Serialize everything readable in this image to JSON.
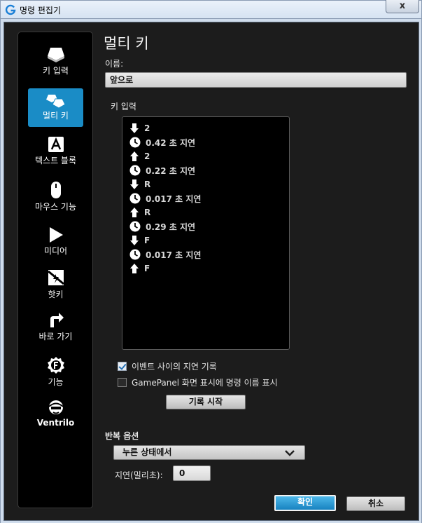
{
  "window": {
    "title": "명령 편집기",
    "close_label": "x"
  },
  "sidebar": {
    "items": [
      {
        "label": "키 입력",
        "icon": "keycap-icon",
        "active": false
      },
      {
        "label": "멀티 키",
        "icon": "multikey-icon",
        "active": true
      },
      {
        "label": "텍스트 블록",
        "icon": "text-a-icon",
        "active": false
      },
      {
        "label": "마우스 기능",
        "icon": "mouse-icon",
        "active": false
      },
      {
        "label": "미디어",
        "icon": "play-icon",
        "active": false
      },
      {
        "label": "핫키",
        "icon": "hotkey-icon",
        "active": false
      },
      {
        "label": "바로 가기",
        "icon": "shortcut-arrow-icon",
        "active": false
      },
      {
        "label": "기능",
        "icon": "function-f-icon",
        "active": false
      },
      {
        "label": "Ventrilo",
        "icon": "headset-icon",
        "active": false
      }
    ]
  },
  "main": {
    "heading": "멀티 키",
    "name_label": "이름:",
    "name_value": "앞으로",
    "keys_label": "키 입력",
    "key_events": [
      {
        "type": "down-arrow-icon",
        "text": "2"
      },
      {
        "type": "clock-icon",
        "text": "0.42 초 지연"
      },
      {
        "type": "up-arrow-icon",
        "text": "2"
      },
      {
        "type": "clock-icon",
        "text": "0.22 초 지연"
      },
      {
        "type": "down-arrow-icon",
        "text": "R"
      },
      {
        "type": "clock-icon",
        "text": "0.017 초 지연"
      },
      {
        "type": "up-arrow-icon",
        "text": "R"
      },
      {
        "type": "clock-icon",
        "text": "0.29 초 지연"
      },
      {
        "type": "down-arrow-icon",
        "text": "F"
      },
      {
        "type": "clock-icon",
        "text": "0.017 초 지연"
      },
      {
        "type": "up-arrow-icon",
        "text": "F"
      }
    ],
    "record_delays_label": "이벤트 사이의 지연 기록",
    "record_delays_checked": true,
    "gamepanel_label": "GamePanel 화면 표시에 명령 이름 표시",
    "gamepanel_checked": false,
    "record_button": "기록 시작"
  },
  "repeat": {
    "label": "반복 옵션",
    "selected": "누른 상태에서",
    "delay_label": "지연(밀리초):",
    "delay_value": "0"
  },
  "footer": {
    "ok": "확인",
    "cancel": "취소"
  },
  "colors": {
    "accent": "#1a8cc6",
    "panel": "#1c1c1c",
    "frame": "#cfdcec"
  }
}
